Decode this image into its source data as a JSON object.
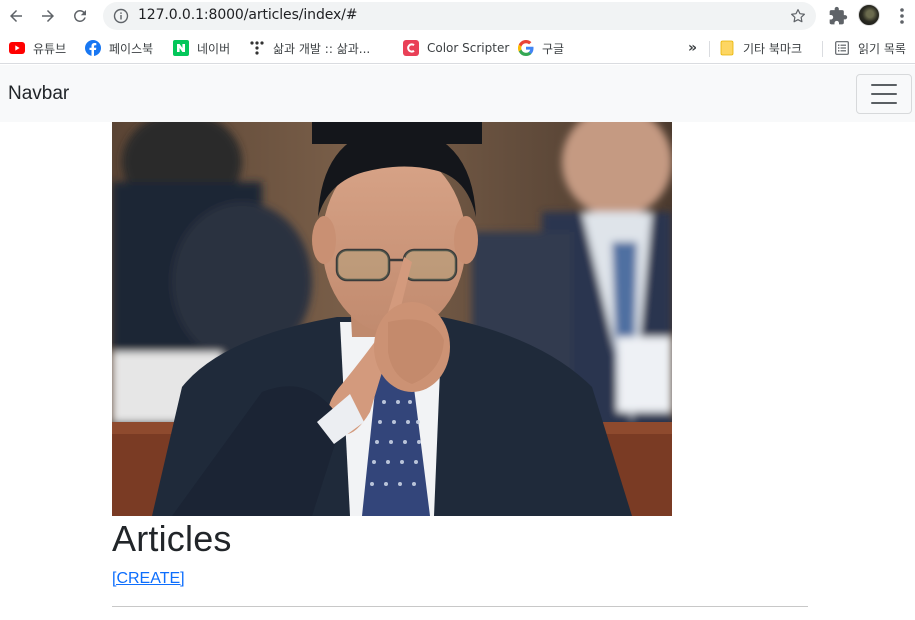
{
  "browser": {
    "url": "127.0.0.1:8000/articles/index/#"
  },
  "bookmarks": {
    "items": [
      {
        "label": "유튜브",
        "icon": "youtube-icon"
      },
      {
        "label": "페이스북",
        "icon": "facebook-icon"
      },
      {
        "label": "네이버",
        "icon": "naver-icon"
      },
      {
        "label": "삶과 개발 :: 삶과...",
        "icon": "dots-icon"
      },
      {
        "label": "Color Scripter",
        "icon": "color-scripter-icon"
      },
      {
        "label": "구글",
        "icon": "google-icon"
      }
    ],
    "overflow": "»",
    "other_folder": "기타 북마크",
    "reading_list": "읽기 목록"
  },
  "navbar": {
    "brand": "Navbar"
  },
  "main": {
    "title": "Articles",
    "create_link": "[CREATE]"
  },
  "colors": {
    "link": "#0d6efd",
    "navbar_bg": "#f8f9fa"
  }
}
